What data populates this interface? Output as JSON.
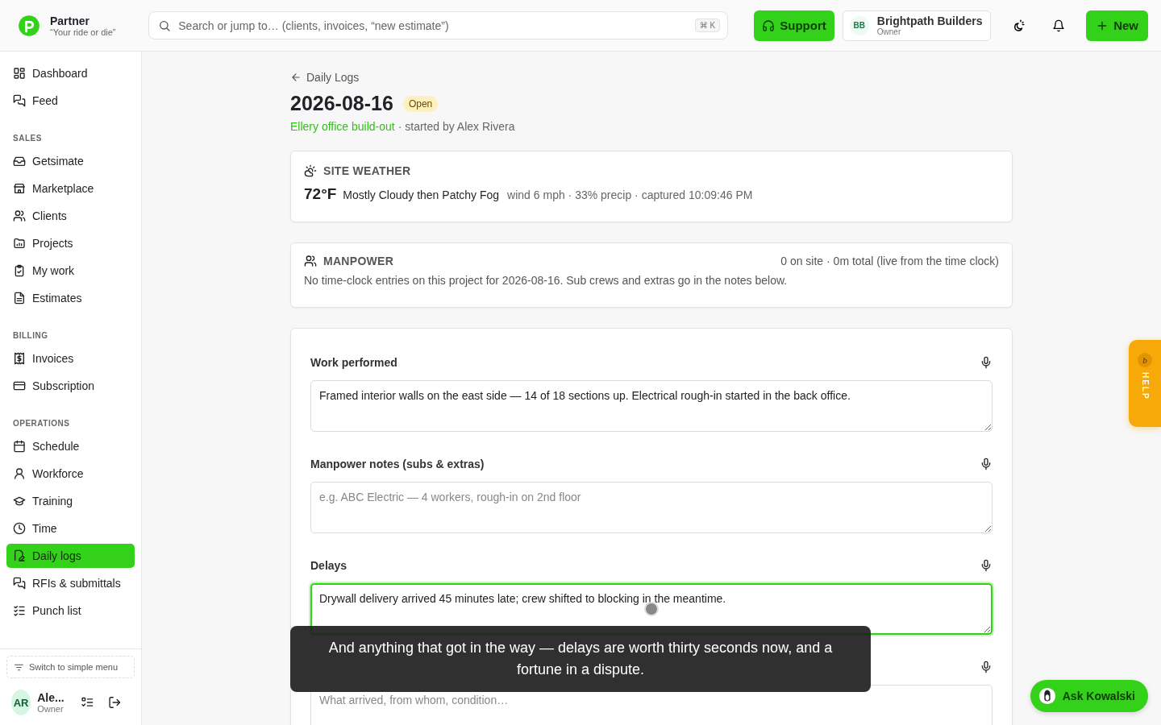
{
  "brand": {
    "name": "Partner",
    "tagline": "“Your ride or die”"
  },
  "search": {
    "placeholder": "Search or jump to… (clients, invoices, “new estimate”)",
    "shortcut": "⌘ K"
  },
  "header": {
    "support": "Support",
    "account": {
      "initials": "BB",
      "name": "Brightpath Builders",
      "role": "Owner"
    },
    "new_button": "New"
  },
  "sidebar": {
    "sections": [
      {
        "items": [
          {
            "label": "Dashboard",
            "selected": false
          },
          {
            "label": "Feed",
            "selected": false
          }
        ]
      },
      {
        "title": "SALES",
        "items": [
          {
            "label": "Getsimate",
            "selected": false
          },
          {
            "label": "Marketplace",
            "selected": false
          },
          {
            "label": "Clients",
            "selected": false
          },
          {
            "label": "Projects",
            "selected": false
          },
          {
            "label": "My work",
            "selected": false
          },
          {
            "label": "Estimates",
            "selected": false
          }
        ]
      },
      {
        "title": "BILLING",
        "items": [
          {
            "label": "Invoices",
            "selected": false
          },
          {
            "label": "Subscription",
            "selected": false
          }
        ]
      },
      {
        "title": "OPERATIONS",
        "items": [
          {
            "label": "Schedule",
            "selected": false
          },
          {
            "label": "Workforce",
            "selected": false
          },
          {
            "label": "Training",
            "selected": false
          },
          {
            "label": "Time",
            "selected": false
          },
          {
            "label": "Daily logs",
            "selected": true
          },
          {
            "label": "RFIs & submittals",
            "selected": false
          },
          {
            "label": "Punch list",
            "selected": false
          }
        ]
      }
    ],
    "switch_menu": "Switch to simple menu",
    "user": {
      "initials": "AR",
      "name": "Ale...",
      "role": "Owner"
    }
  },
  "page": {
    "back": "Daily Logs",
    "title": "2026-08-16",
    "status": "Open",
    "project": "Ellery office build-out",
    "started_by": "· started by Alex Rivera"
  },
  "weather": {
    "title": "SITE WEATHER",
    "temp": "72°F",
    "summary": "Mostly Cloudy then Patchy Fog",
    "details": "wind 6 mph · 33% precip · captured 10:09:46 PM"
  },
  "manpower": {
    "title": "MANPOWER",
    "summary": "0 on site · 0m total (live from the time clock)",
    "note": "No time-clock entries on this project for 2026-08-16. Sub crews and extras go in the notes below."
  },
  "fields": [
    {
      "label": "Work performed",
      "value": "Framed interior walls on the east side — 14 of 18 sections up. Electrical rough-in started in the back office.",
      "focused": false
    },
    {
      "label": "Manpower notes (subs & extras)",
      "placeholder": "e.g. ABC Electric — 4 workers, rough-in on 2nd floor",
      "focused": false
    },
    {
      "label": "Delays",
      "value": "Drywall delivery arrived 45 minutes late; crew shifted to blocking in the meantime.",
      "focused": true
    },
    {
      "placeholder": "What arrived, from whom, condition…",
      "focused": false
    }
  ],
  "caption": "And anything that got in the way — delays are worth thirty seconds now, and a fortune in a dispute.",
  "help_tab": {
    "badge": "b",
    "label": "HELP"
  },
  "assistant": {
    "label": "Ask Kowalski"
  }
}
